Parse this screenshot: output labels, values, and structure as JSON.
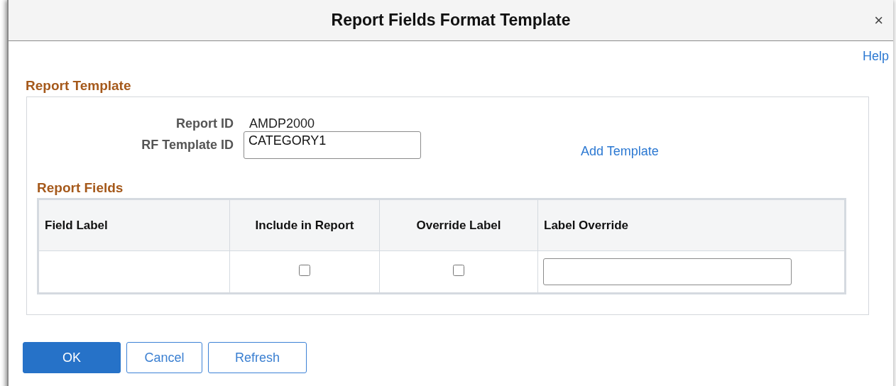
{
  "window": {
    "title": "Report Fields Format Template",
    "close": "×"
  },
  "help_link": "Help",
  "report_template": {
    "heading": "Report Template",
    "report_id_label": "Report ID",
    "report_id": "AMDP2000",
    "template_id_label": "RF Template ID",
    "template_id": "CATEGORY1",
    "add_link": "Add Template"
  },
  "report_fields": {
    "heading": "Report Fields",
    "columns": [
      "Field Label",
      "Include in Report",
      "Override Label",
      "Label Override"
    ],
    "rows": [
      {
        "field_label": "",
        "include": false,
        "override": false,
        "label_override": ""
      }
    ]
  },
  "buttons": [
    {
      "label": "OK",
      "primary": true
    },
    {
      "label": "Cancel",
      "primary": false
    },
    {
      "label": "Refresh",
      "primary": false
    }
  ]
}
